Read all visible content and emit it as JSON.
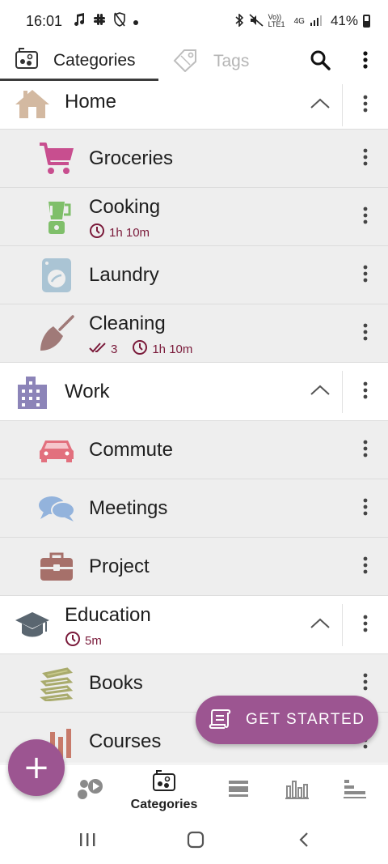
{
  "status": {
    "time": "16:01",
    "network_label": "Vo)) LTE1",
    "signal_label": "4G",
    "battery": "41%"
  },
  "tabs": {
    "categories": "Categories",
    "tags": "Tags"
  },
  "groups": {
    "home": {
      "title": "Home",
      "children": {
        "groceries": {
          "title": "Groceries"
        },
        "cooking": {
          "title": "Cooking",
          "time": "1h 10m"
        },
        "laundry": {
          "title": "Laundry"
        },
        "cleaning": {
          "title": "Cleaning",
          "done": "3",
          "time": "1h 10m"
        }
      }
    },
    "work": {
      "title": "Work",
      "children": {
        "commute": {
          "title": "Commute"
        },
        "meetings": {
          "title": "Meetings"
        },
        "project": {
          "title": "Project"
        }
      }
    },
    "education": {
      "title": "Education",
      "time": "5m",
      "children": {
        "books": {
          "title": "Books"
        },
        "courses": {
          "title": "Courses"
        }
      }
    }
  },
  "get_started": "GET STARTED",
  "fab_icon": "+",
  "bottom_nav": {
    "categories": "Categories"
  },
  "colors": {
    "accent": "#9c5591",
    "meta": "#7a1a3a"
  }
}
